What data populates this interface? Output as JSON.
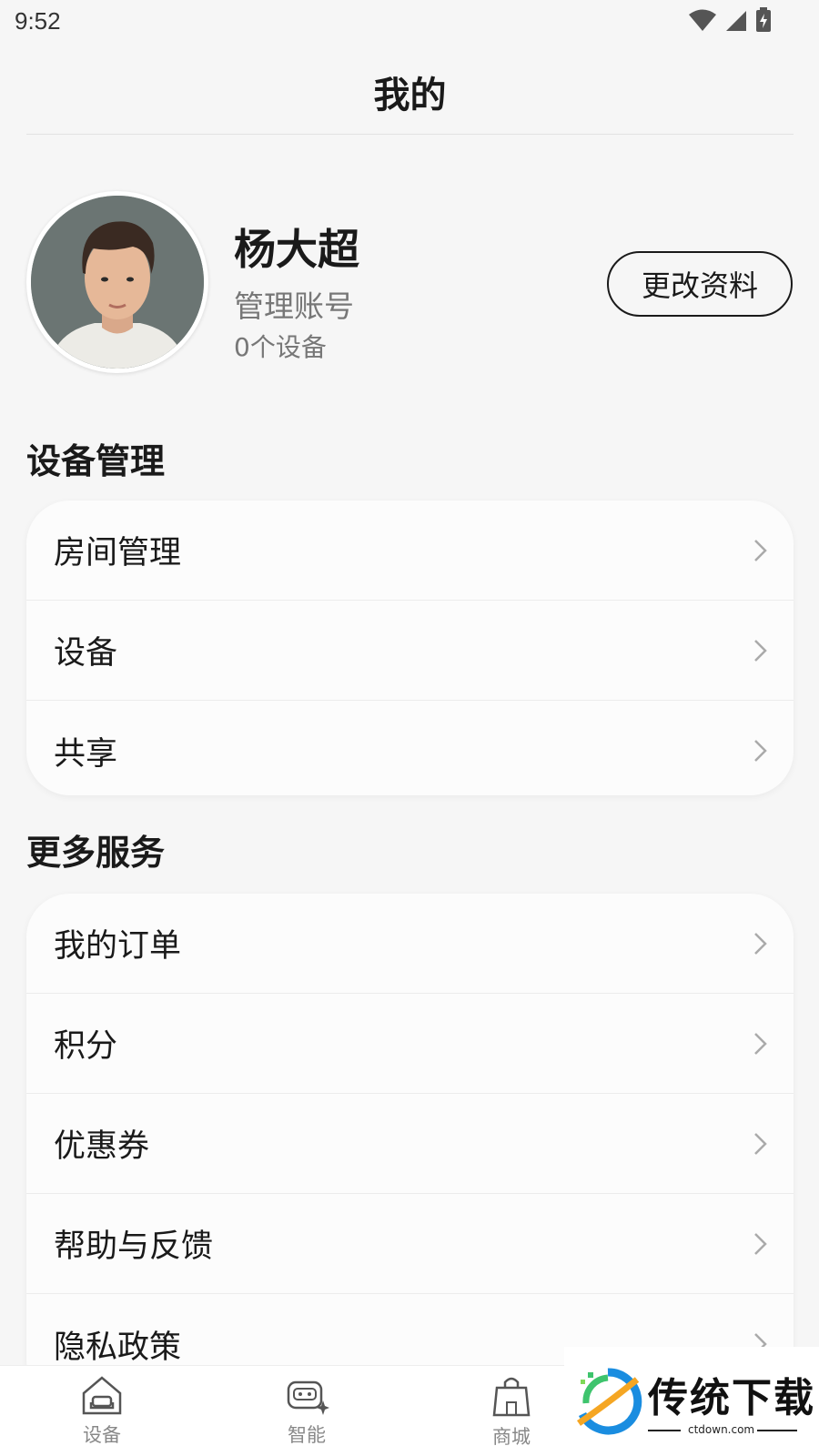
{
  "status_bar": {
    "time": "9:52"
  },
  "header": {
    "title": "我的"
  },
  "profile": {
    "name": "杨大超",
    "role": "管理账号",
    "devices": "0个设备",
    "edit_label": "更改资料"
  },
  "device_management": {
    "title": "设备管理",
    "items": [
      {
        "label": "房间管理"
      },
      {
        "label": "设备"
      },
      {
        "label": "共享"
      }
    ]
  },
  "more_services": {
    "title": "更多服务",
    "items": [
      {
        "label": "我的订单"
      },
      {
        "label": "积分"
      },
      {
        "label": "优惠券"
      },
      {
        "label": "帮助与反馈"
      },
      {
        "label": "隐私政策"
      }
    ]
  },
  "tabbar": {
    "tabs": [
      {
        "label": "设备",
        "icon": "home-sofa-icon"
      },
      {
        "label": "智能",
        "icon": "robot-icon"
      },
      {
        "label": "商城",
        "icon": "shopping-bag-icon"
      }
    ]
  },
  "watermark": {
    "text": "传统下载",
    "url": "ctdown.com"
  }
}
